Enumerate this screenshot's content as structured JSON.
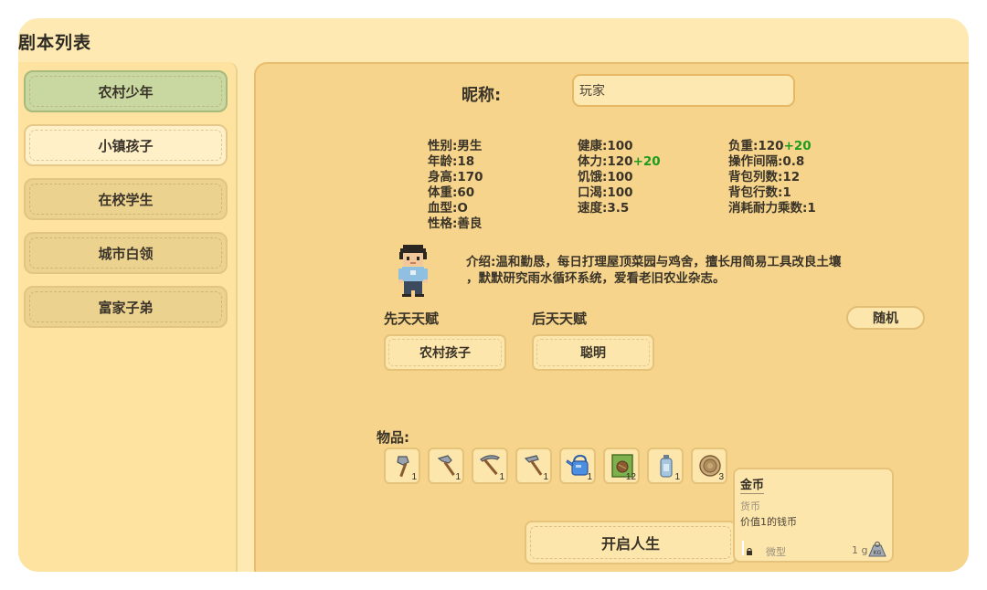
{
  "window": {
    "title": "剧本列表"
  },
  "sidebar": {
    "items": [
      {
        "label": "农村少年",
        "state": "active"
      },
      {
        "label": "小镇孩子",
        "state": "hover"
      },
      {
        "label": "在校学生",
        "state": "normal"
      },
      {
        "label": "城市白领",
        "state": "normal"
      },
      {
        "label": "富家子弟",
        "state": "normal"
      }
    ]
  },
  "profile": {
    "nickname_label": "昵称:",
    "nickname_value": "玩家",
    "stats_col1": [
      "性别:男生",
      "年龄:18",
      "身高:170",
      "体重:60",
      "血型:O",
      "性格:善良"
    ],
    "stats_col2": {
      "health": "健康:100",
      "stamina": "体力:120",
      "stamina_bonus": "+20",
      "hunger": "饥饿:100",
      "thirst": "口渴:100",
      "speed": "速度:3.5"
    },
    "stats_col3": {
      "load": "负重:120",
      "load_bonus": "+20",
      "interval": "操作间隔:0.8",
      "bag_cols": "背包列数:12",
      "bag_rows": "背包行数:1",
      "durability": "消耗耐力乘数:1"
    },
    "intro_line1": "介绍:温和勤恳，每日打理屋顶菜园与鸡舍，擅长用简易工具改良土壤",
    "intro_line2": "，默默研究雨水循环系统，爱看老旧农业杂志。"
  },
  "talents": {
    "innate_label": "先天天赋",
    "innate_value": "农村孩子",
    "acquired_label": "后天天赋",
    "acquired_value": "聪明",
    "random_label": "随机"
  },
  "items": {
    "label": "物品:",
    "slots": [
      {
        "icon": "axe-icon",
        "count": "1"
      },
      {
        "icon": "hammer-icon",
        "count": "1"
      },
      {
        "icon": "pickaxe-icon",
        "count": "1"
      },
      {
        "icon": "hoe-icon",
        "count": "1"
      },
      {
        "icon": "watering-can-icon",
        "count": "1"
      },
      {
        "icon": "seed-bag-icon",
        "count": "12"
      },
      {
        "icon": "bottle-icon",
        "count": "1"
      },
      {
        "icon": "coin-icon",
        "count": "3"
      }
    ]
  },
  "start_button": "开启人生",
  "tooltip": {
    "title": "金币",
    "type": "货币",
    "description": "价值1的钱币",
    "size": "微型",
    "weight": "1 g"
  },
  "colors": {
    "bonus": "#1d9c1d",
    "active_item": "#c9d7a0",
    "panel": "#f6d48b"
  }
}
